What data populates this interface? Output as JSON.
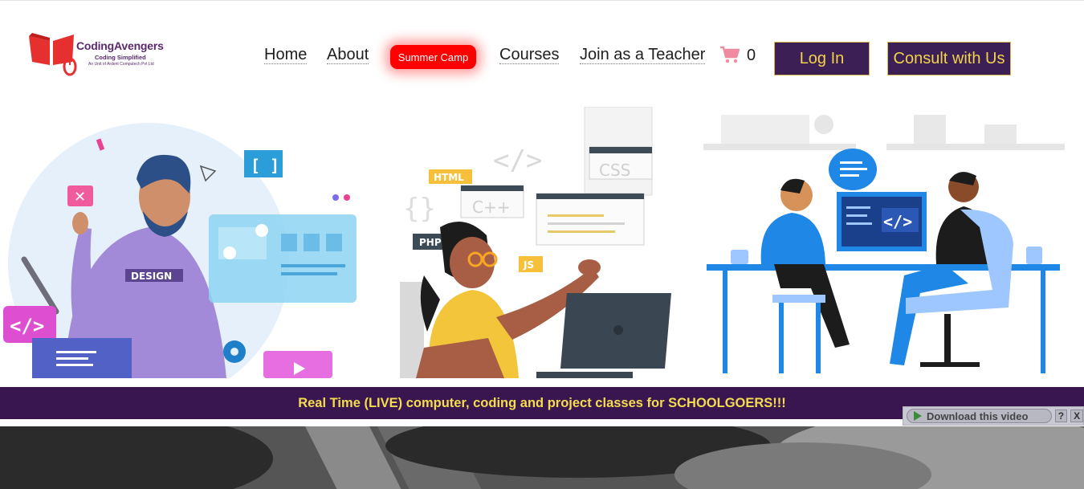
{
  "logo": {
    "name": "CodingAvengers",
    "tagline": "Coding Simplified",
    "unit": "An Unit of Ardent Computech Pvt Ltd"
  },
  "nav": {
    "home": "Home",
    "about": "About",
    "summer_camp": "Summer Camp",
    "courses": "Courses",
    "join_teacher": "Join as a Teacher",
    "cart_count": "0",
    "cart_icon": "shopping-cart-icon"
  },
  "buttons": {
    "login": "Log In",
    "consult": "Consult with Us"
  },
  "hero": {
    "panel1_text": "DESIGN",
    "panel2_labels": [
      "HTML",
      "C++",
      "CSS",
      "PHP",
      "JS"
    ],
    "panel3_code": "</>"
  },
  "banner": {
    "text": "Real Time (LIVE) computer, coding and project classes for SCHOOLGOERS!!!"
  },
  "download_bar": {
    "label": "Download this video",
    "help": "?",
    "close": "X"
  },
  "colors": {
    "accent": "#3c1f55",
    "button_text": "#f1d34a",
    "summer_camp": "#ff0000"
  }
}
